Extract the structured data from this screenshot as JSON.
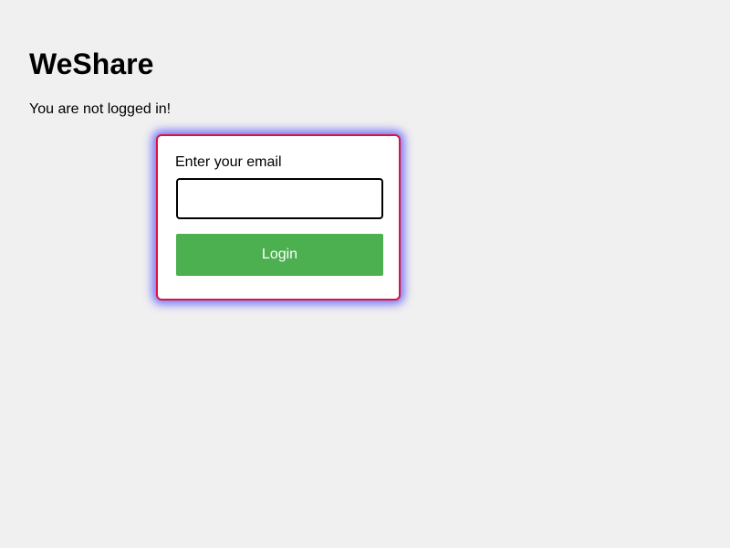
{
  "app": {
    "title": "WeShare"
  },
  "auth": {
    "status_text": "You are not logged in!"
  },
  "login_form": {
    "email_label": "Enter your email",
    "email_value": "",
    "email_placeholder": "",
    "login_label": "Login"
  },
  "colors": {
    "background": "#f0f0f0",
    "card_border": "#dc143c",
    "card_glow": "#4646ff",
    "button_bg": "#4caf50",
    "button_text": "#ffffff"
  }
}
